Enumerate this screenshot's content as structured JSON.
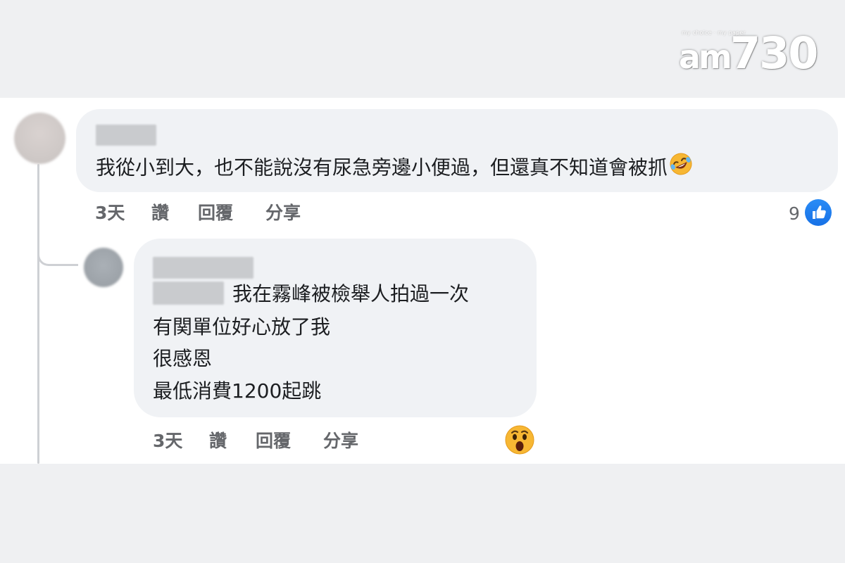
{
  "watermark": {
    "tagline": "my choice · my paper",
    "brand_prefix": "am",
    "brand_number": "730"
  },
  "comments": [
    {
      "text": "我從小到大，也不能說沒有尿急旁邊小便過，但還真不知道會被抓",
      "trailing_emoji": "rolling-on-floor-laughing-emoji",
      "actions": {
        "time": "3天",
        "like": "讚",
        "reply": "回覆",
        "share": "分享"
      },
      "reaction": {
        "type": "like-reaction-icon",
        "count": "9"
      }
    },
    {
      "lines": [
        "我在霧峰被檢舉人拍過一次",
        "有関單位好心放了我",
        "很感恩",
        "最低消費1200起跳"
      ],
      "actions": {
        "time": "3天",
        "like": "讚",
        "reply": "回覆",
        "share": "分享"
      },
      "reaction": {
        "type": "wow-reaction-icon"
      }
    }
  ],
  "colors": {
    "background": "#eff0f2",
    "bubble": "#f0f2f5",
    "action_text": "#65676b",
    "like_blue": "#1877f2"
  }
}
